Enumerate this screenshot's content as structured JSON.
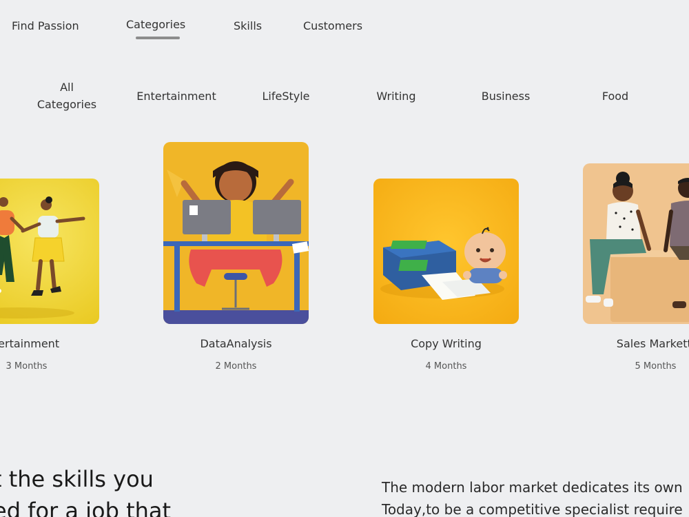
{
  "nav": {
    "items": [
      {
        "label": "Find Passion"
      },
      {
        "label": "Categories"
      },
      {
        "label": "Skills"
      },
      {
        "label": "Customers"
      }
    ],
    "active": "Categories"
  },
  "filters": {
    "items": [
      {
        "label": "All\nCategories"
      },
      {
        "label": "Entertainment"
      },
      {
        "label": "LifeStyle"
      },
      {
        "label": "Writing"
      },
      {
        "label": "Business"
      },
      {
        "label": "Food"
      }
    ]
  },
  "courses": [
    {
      "title": "tertainment",
      "duration": "3 Months",
      "image": "dancing-couple-illustration"
    },
    {
      "title": "DataAnalysis",
      "duration": "2 Months",
      "image": "woman-at-desk-with-monitors-illustration"
    },
    {
      "title": "Copy Writing",
      "duration": "4 Months",
      "image": "printer-and-baby-illustration"
    },
    {
      "title": "Sales Marketti",
      "duration": "5 Months",
      "image": "two-people-sitting-illustration"
    }
  ],
  "hero": {
    "headline_line1": "t the skills you",
    "headline_line2": "ed for a job that",
    "para_line1": "The modern labor market dedicates its own",
    "para_line2": "Today,to be a competitive specialist require"
  },
  "colors": {
    "background": "#eeeff1",
    "card_yellow": "#f2b521",
    "card_peach": "#f0c48f"
  }
}
